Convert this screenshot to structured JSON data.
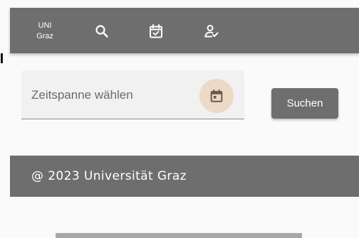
{
  "header": {
    "logo_line1": "UNI",
    "logo_line2": "Graz",
    "icons": [
      "search-icon",
      "calendar-check-icon",
      "person-check-icon"
    ]
  },
  "search_form": {
    "date_range_placeholder": "Zeitspanne wählen",
    "date_picker_icon": "calendar-icon",
    "search_label": "Suchen"
  },
  "footer": {
    "copyright": "@ 2023 Universität Graz"
  },
  "colors": {
    "toolbar": "#6e6e6e",
    "page_background": "#fafafa",
    "field_background": "#f1f1f1",
    "date_toggle_background": "#ecd9c6",
    "date_icon": "#6b5b4e"
  }
}
